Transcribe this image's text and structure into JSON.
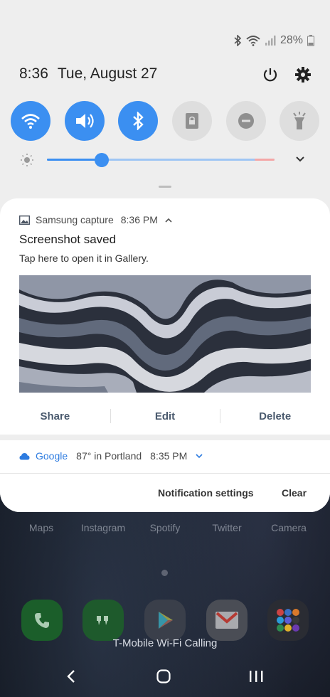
{
  "status_bar": {
    "battery": "28%"
  },
  "header": {
    "time": "8:36",
    "date": "Tue, August 27"
  },
  "quick_settings": [
    {
      "name": "wifi",
      "state": "on"
    },
    {
      "name": "sound",
      "state": "on"
    },
    {
      "name": "bluetooth",
      "state": "on"
    },
    {
      "name": "screen-lock",
      "state": "off"
    },
    {
      "name": "do-not-disturb",
      "state": "off"
    },
    {
      "name": "flashlight",
      "state": "off"
    }
  ],
  "brightness": {
    "level": 0.24
  },
  "notifications": {
    "capture": {
      "app": "Samsung capture",
      "time": "8:36 PM",
      "title": "Screenshot saved",
      "text": "Tap here to open it in Gallery.",
      "actions": [
        "Share",
        "Edit",
        "Delete"
      ]
    },
    "google": {
      "app": "Google",
      "summary": "87° in Portland",
      "time": "8:35 PM"
    }
  },
  "footer": {
    "settings": "Notification settings",
    "clear": "Clear"
  },
  "home": {
    "apps": [
      "Maps",
      "Instagram",
      "Spotify",
      "Twitter",
      "Camera"
    ],
    "carrier": "T-Mobile Wi-Fi Calling"
  },
  "colors": {
    "accent": "#3b8ff1",
    "panel": "#eeeeee",
    "card": "#ffffff"
  }
}
